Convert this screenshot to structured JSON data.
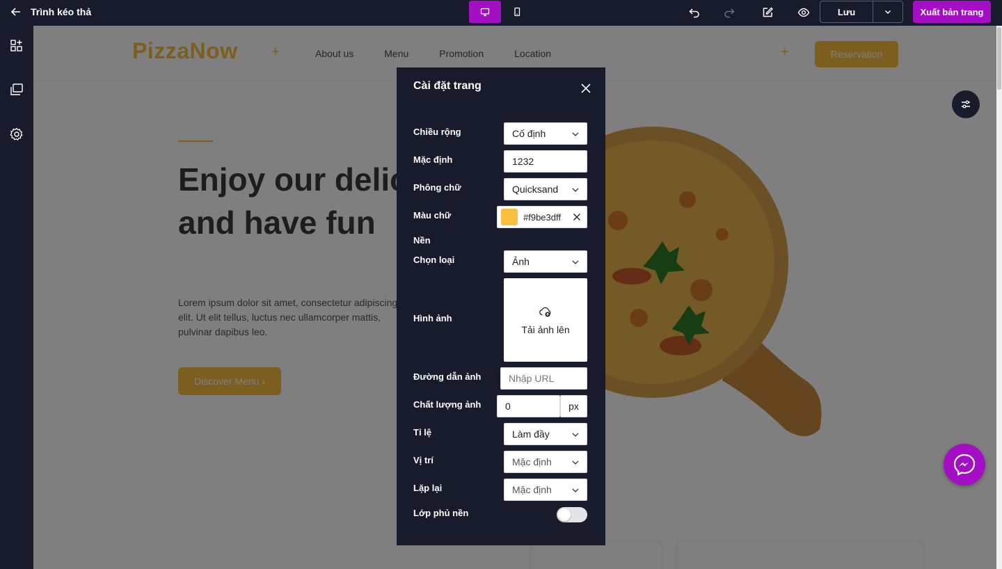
{
  "app": {
    "title": "Trình kéo thả"
  },
  "toolbar": {
    "save_label": "Lưu",
    "export_label": "Xuất bản trang",
    "active_color": "#a40ec4"
  },
  "site": {
    "logo": "PizzaNow",
    "nav": [
      "About us",
      "Menu",
      "Promotion",
      "Location"
    ],
    "reserve_label": "Reservation",
    "hero_title": "Enjoy our delicious meal and have fun",
    "hero_text": "Lorem ipsum dolor sit amet, consectetur adipiscing elit. Ut elit tellus, luctus nec ullamcorper mattis, pulvinar dapibus leo.",
    "discover_label": "Discover Menu",
    "brand_color": "#f9be3d"
  },
  "modal": {
    "title": "Cài đặt trang",
    "width_label": "Chiều rộng",
    "width_value": "Cố định",
    "default_label": "Mặc định",
    "default_value": "1232",
    "font_label": "Phông chữ",
    "font_value": "Quicksand",
    "color_label": "Màu chữ",
    "color_value": "#f9be3dff",
    "bg_section_label": "Nền",
    "type_label": "Chọn loại",
    "type_value": "Ảnh",
    "image_label": "Hình ảnh",
    "upload_label": "Tải ảnh lên",
    "url_label": "Đường dẫn ảnh",
    "url_placeholder": "Nhập URL",
    "quality_label": "Chất lượng ảnh",
    "quality_value": "0",
    "quality_unit": "px",
    "ratio_label": "Tỉ lệ",
    "ratio_value": "Làm đầy",
    "position_label": "Vị trí",
    "position_value": "Mặc định",
    "repeat_label": "Lặp lại",
    "repeat_value": "Mặc định",
    "overlay_label": "Lớp phủ nền",
    "overlay_on": false
  }
}
